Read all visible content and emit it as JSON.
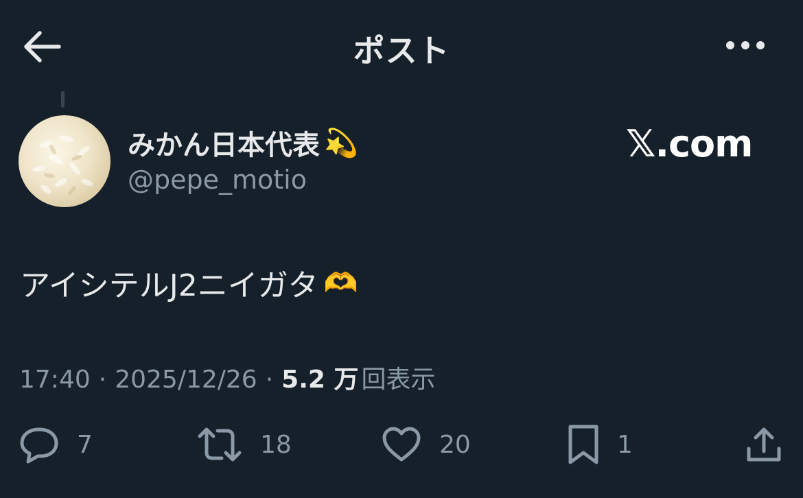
{
  "header": {
    "title": "ポスト",
    "back_icon": "arrow-left-icon",
    "more_icon": "more-horizontal-icon"
  },
  "author": {
    "display_name": "みかん日本代表",
    "display_name_emoji": "💫",
    "handle": "@pepe_motio"
  },
  "watermark": "𝕏.com",
  "tweet": {
    "text": "アイシテルJ2ニイガタ",
    "emoji": "🫶"
  },
  "meta": {
    "time": "17:40",
    "separator": "·",
    "date": "2025/12/26",
    "views_value": "5.2 万",
    "views_label": "回表示"
  },
  "actions": {
    "reply": {
      "icon": "reply-icon",
      "count": "7"
    },
    "repost": {
      "icon": "repost-icon",
      "count": "18"
    },
    "like": {
      "icon": "heart-icon",
      "count": "20"
    },
    "bookmark": {
      "icon": "bookmark-icon",
      "count": "1"
    },
    "share": {
      "icon": "share-icon"
    }
  },
  "colors": {
    "background": "#15202b",
    "primary_text": "#e7e9ea",
    "secondary_text": "#8b98a5",
    "divider": "#38444d"
  }
}
